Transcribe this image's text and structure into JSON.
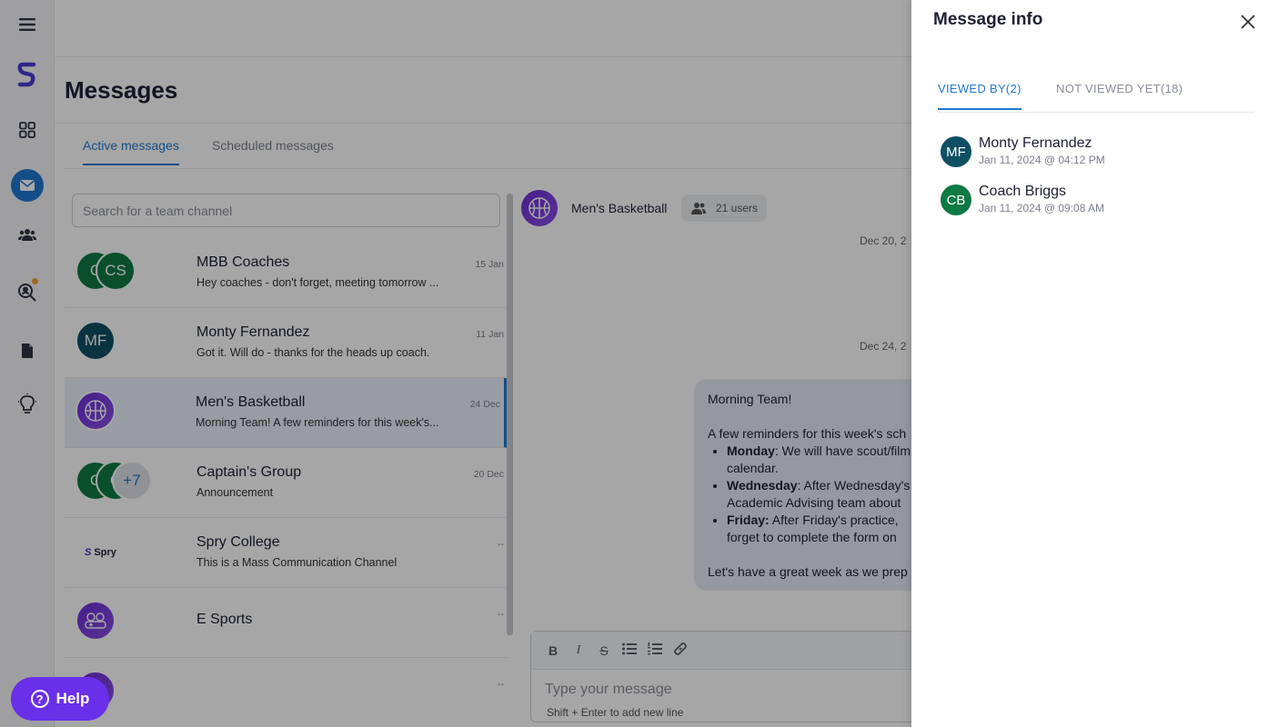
{
  "page": {
    "title": "Messages"
  },
  "tabs": {
    "active": "Active messages",
    "scheduled": "Scheduled messages"
  },
  "search": {
    "placeholder": "Search for a team channel"
  },
  "conversations": [
    {
      "name": "MBB Coaches",
      "preview": "Hey coaches - don't forget, meeting tomorrow ...",
      "date": "15 Jan",
      "avatars": [
        "C",
        "CS"
      ]
    },
    {
      "name": "Monty Fernandez",
      "preview": "Got it. Will do - thanks for the heads up coach.",
      "date": "11 Jan",
      "avatars": [
        "MF"
      ]
    },
    {
      "name": "Men's Basketball",
      "preview": "Morning Team! A few reminders for this week's...",
      "date": "24 Dec",
      "icon": "basketball-icon"
    },
    {
      "name": "Captain's Group",
      "preview": "Announcement",
      "date": "20 Dec",
      "avatars": [
        "C",
        "C",
        "+7"
      ]
    },
    {
      "name": "Spry College",
      "preview": "This is a Mass Communication Channel",
      "date": "--",
      "logo": "Spry"
    },
    {
      "name": "E Sports",
      "preview": "",
      "date": "--",
      "icon": "gamepad-icon"
    },
    {
      "name": "",
      "preview": "",
      "date": "--"
    }
  ],
  "chat": {
    "name": "Men's Basketball",
    "users": "21 users",
    "dates": [
      "Dec 20, 2",
      "Dec 24, 2"
    ],
    "message": {
      "greeting": "Morning Team!",
      "intro": "A few reminders for this week's sch",
      "items": [
        {
          "bold": "Monday",
          "text": ": We will have scout/film",
          "cont": "calendar."
        },
        {
          "bold": "Wednesday",
          "text": ": After Wednesday's",
          "cont": "Academic Advising team about"
        },
        {
          "bold": "Friday:",
          "text": " After Friday's practice,",
          "cont": "forget to complete the form on"
        }
      ],
      "closing": "Let's have a great week as we prep"
    },
    "composer": {
      "placeholder": "Type your message",
      "hint": "Shift + Enter to add new line"
    }
  },
  "help": {
    "label": "Help"
  },
  "drawer": {
    "title": "Message info",
    "tabs": {
      "viewed": "VIEWED BY(2)",
      "not_viewed": "NOT VIEWED YET(18)"
    },
    "viewers": [
      {
        "initials": "MF",
        "name": "Monty Fernandez",
        "time": "Jan 11, 2024 @ 04:12 PM",
        "color": "#0f4f64"
      },
      {
        "initials": "CB",
        "name": "Coach Briggs",
        "time": "Jan 11, 2024 @ 09:08 AM",
        "color": "#0f7a43"
      }
    ]
  },
  "colors": {
    "accent": "#1f78d1",
    "help": "#6a2fe8",
    "brand": "#3b2cc8"
  }
}
